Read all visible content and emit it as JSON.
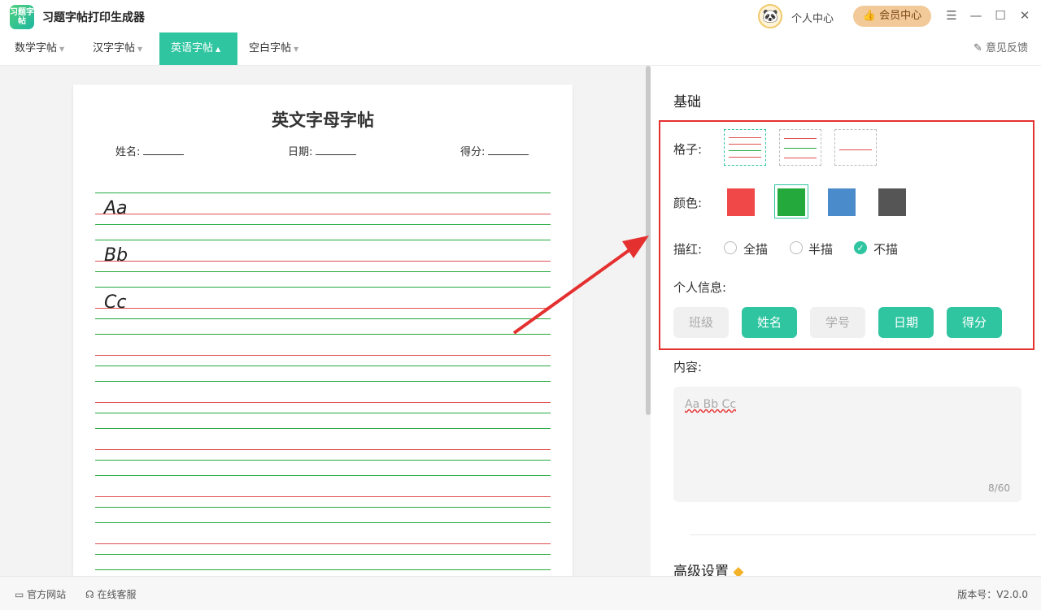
{
  "app": {
    "logo_text": "习题字帖",
    "title": "习题字帖打印生成器",
    "user_center": "个人中心",
    "vip": "会员中心"
  },
  "tabs": [
    {
      "label": "数学字帖"
    },
    {
      "label": "汉字字帖"
    },
    {
      "label": "英语字帖"
    },
    {
      "label": "空白字帖"
    }
  ],
  "feedback": "意见反馈",
  "paper": {
    "title": "英文字母字帖",
    "fields": [
      {
        "label": "姓名:"
      },
      {
        "label": "日期:"
      },
      {
        "label": "得分:"
      }
    ],
    "letters": [
      "Aa",
      "Bb",
      "Cc"
    ]
  },
  "panel": {
    "basic_title": "基础",
    "grid_label": "格子:",
    "color_label": "颜色:",
    "trace_label": "描红:",
    "trace_options": [
      "全描",
      "半描",
      "不描"
    ],
    "trace_selected": "不描",
    "info_label": "个人信息:",
    "info_buttons": [
      "班级",
      "姓名",
      "学号",
      "日期",
      "得分"
    ],
    "content_label": "内容:",
    "content_value": "Aa Bb Cc",
    "content_count": "8/60",
    "advanced_title": "高级设置"
  },
  "colors": {
    "red": "#f04848",
    "green": "#23a93c",
    "blue": "#4a8ccb",
    "gray": "#555555",
    "accent": "#2fc5a0"
  },
  "status": {
    "website": "官方网站",
    "service": "在线客服",
    "version": "版本号：V2.0.0"
  }
}
